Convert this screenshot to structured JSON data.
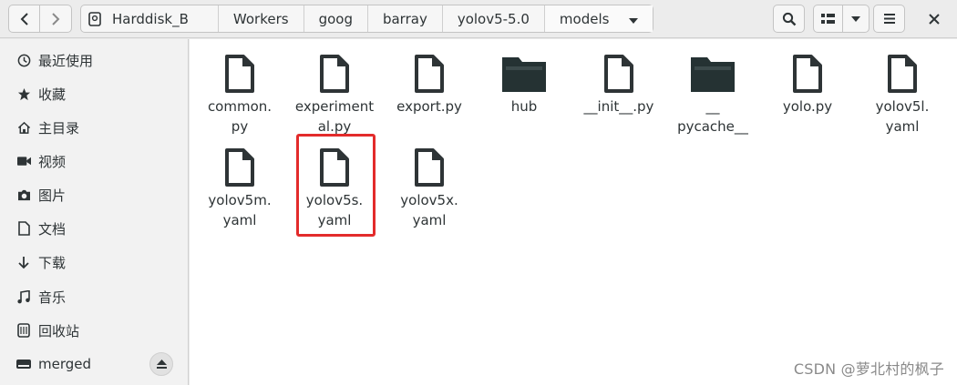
{
  "nav": {
    "back_icon": "chevron-left",
    "forward_icon": "chevron-right"
  },
  "path": [
    "Harddisk_B",
    "Workers",
    "goog",
    "barray",
    "yolov5-5.0",
    "models"
  ],
  "sidebar": {
    "items": [
      {
        "label": "最近使用",
        "icon": "clock-icon"
      },
      {
        "label": "收藏",
        "icon": "star-icon"
      },
      {
        "label": "主目录",
        "icon": "home-icon"
      },
      {
        "label": "视频",
        "icon": "video-icon"
      },
      {
        "label": "图片",
        "icon": "camera-icon"
      },
      {
        "label": "文档",
        "icon": "document-icon"
      },
      {
        "label": "下载",
        "icon": "download-icon"
      },
      {
        "label": "音乐",
        "icon": "music-icon"
      },
      {
        "label": "回收站",
        "icon": "trash-icon"
      },
      {
        "label": "merged",
        "icon": "drive-icon"
      }
    ]
  },
  "files": [
    {
      "name": "common.py",
      "kind": "file"
    },
    {
      "name": "experimental.py",
      "kind": "file"
    },
    {
      "name": "export.py",
      "kind": "file"
    },
    {
      "name": "hub",
      "kind": "folder"
    },
    {
      "name": "__init__.py",
      "kind": "file"
    },
    {
      "name": "__pycache__",
      "kind": "folder"
    },
    {
      "name": "yolo.py",
      "kind": "file"
    },
    {
      "name": "yolov5l.yaml",
      "kind": "file"
    },
    {
      "name": "yolov5m.yaml",
      "kind": "file"
    },
    {
      "name": "yolov5s.yaml",
      "kind": "file"
    },
    {
      "name": "yolov5x.yaml",
      "kind": "file"
    }
  ],
  "file_labels": {
    "common": [
      "common.",
      "py"
    ],
    "experimental": [
      "experiment",
      "al.py"
    ],
    "export": [
      "export.py"
    ],
    "hub": [
      "hub"
    ],
    "init": [
      "__init__.py"
    ],
    "pycache": [
      "__",
      "pycache__"
    ],
    "yolo": [
      "yolo.py"
    ],
    "yolov5l": [
      "yolov5l.",
      "yaml"
    ],
    "yolov5m": [
      "yolov5m.",
      "yaml"
    ],
    "yolov5s": [
      "yolov5s.",
      "yaml"
    ],
    "yolov5x": [
      "yolov5x.",
      "yaml"
    ]
  },
  "highlight_color": "#e32b2b",
  "watermark": "CSDN @萝北村的枫子"
}
